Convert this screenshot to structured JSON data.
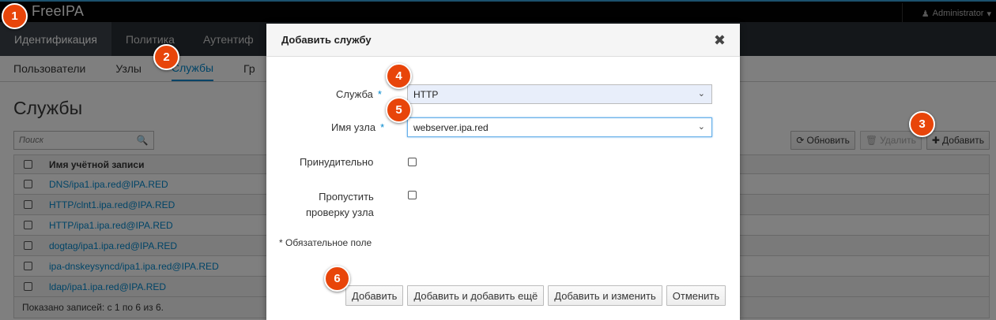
{
  "brand": "FreeIPA",
  "user_menu": {
    "label": "Administrator",
    "icon": "user-icon"
  },
  "primary_nav": [
    "Идентификация",
    "Политика",
    "Аутентиф"
  ],
  "secondary_nav": [
    "Пользователи",
    "Узлы",
    "Службы",
    "Гр"
  ],
  "page": {
    "title": "Службы",
    "search_placeholder": "Поиск",
    "toolbar": {
      "refresh": "Обновить",
      "delete": "Удалить",
      "add": "Добавить"
    },
    "table": {
      "column_header": "Имя учётной записи",
      "rows": [
        "DNS/ipa1.ipa.red@IPA.RED",
        "HTTP/clnt1.ipa.red@IPA.RED",
        "HTTP/ipa1.ipa.red@IPA.RED",
        "dogtag/ipa1.ipa.red@IPA.RED",
        "ipa-dnskeysyncd/ipa1.ipa.red@IPA.RED",
        "ldap/ipa1.ipa.red@IPA.RED"
      ],
      "footer": "Показано записей: с 1 по 6 из 6."
    }
  },
  "dialog": {
    "title": "Добавить службу",
    "close": "✖",
    "service_label": "Служба",
    "service_value": "HTTP",
    "host_label": "Имя узла",
    "host_value": "webserver.ipa.red",
    "force_label": "Принудительно",
    "skip_label_line1": "Пропустить",
    "skip_label_line2": "проверку узла",
    "required_star": "*",
    "required_note": "* Обязательное поле",
    "buttons": {
      "add": "Добавить",
      "add_another": "Добавить и добавить ещё",
      "add_edit": "Добавить и изменить",
      "cancel": "Отменить"
    }
  },
  "badges": [
    "1",
    "2",
    "3",
    "4",
    "5",
    "6"
  ],
  "colors": {
    "accent": "#0088ce",
    "badge": "#e8450a",
    "nav_dark": "#292e34"
  }
}
